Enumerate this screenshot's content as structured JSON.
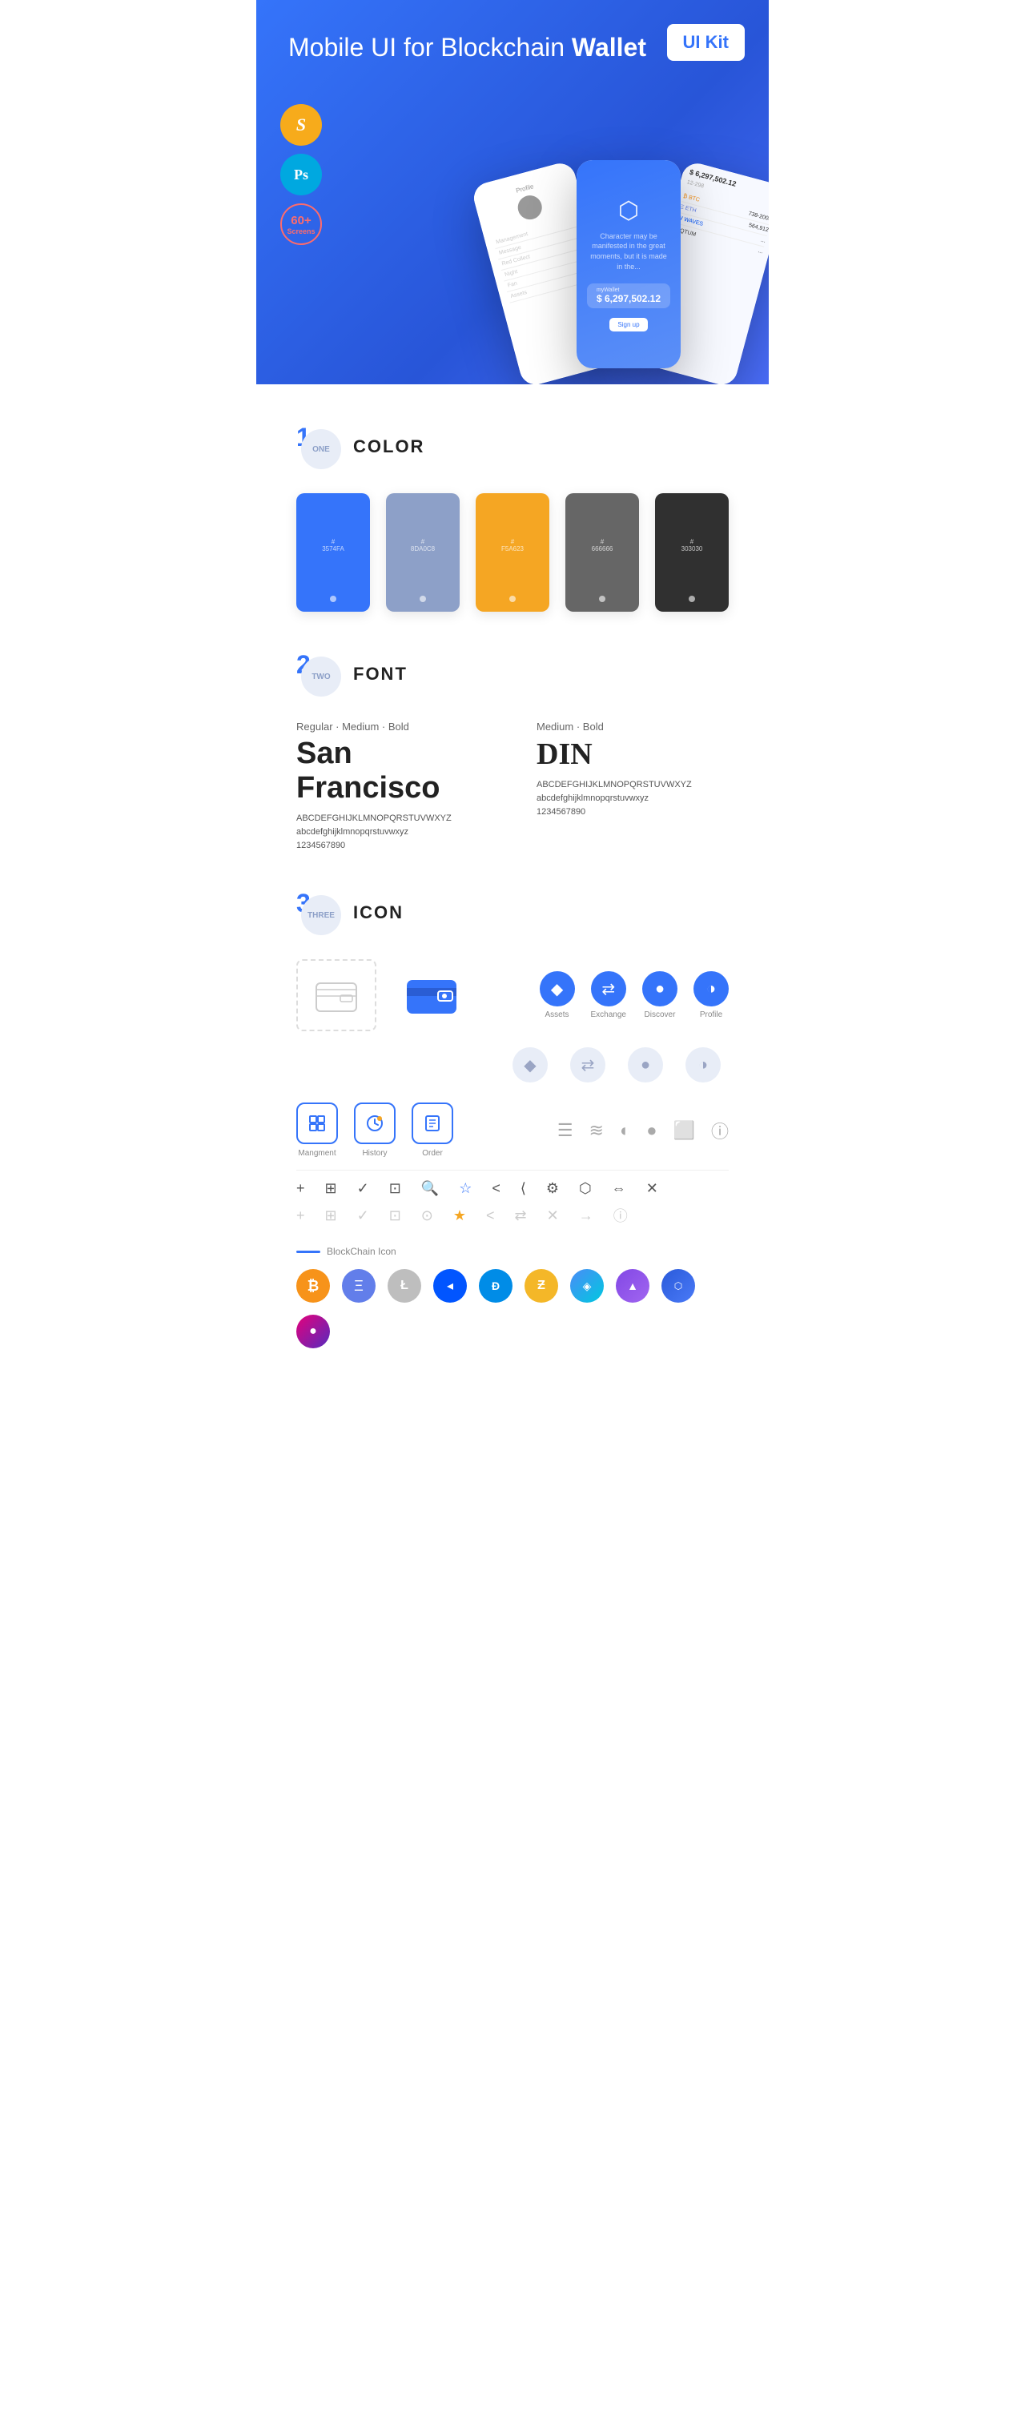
{
  "hero": {
    "title": "Mobile UI for Blockchain ",
    "title_bold": "Wallet",
    "badge": "UI Kit",
    "badges": [
      {
        "label": "Sketch",
        "type": "sketch"
      },
      {
        "label": "Ps",
        "type": "ps"
      },
      {
        "label": "60+\nScreens",
        "type": "screens"
      }
    ]
  },
  "sections": {
    "color": {
      "number": "1",
      "number_text": "ONE",
      "title": "COLOR",
      "swatches": [
        {
          "hex": "#3574FA",
          "code": "#\n3574FA"
        },
        {
          "hex": "#8DA0C8",
          "code": "#\n8DA0C8"
        },
        {
          "hex": "#F5A623",
          "code": "#\nF5A623"
        },
        {
          "hex": "#666666",
          "code": "#\n666666"
        },
        {
          "hex": "#303030",
          "code": "#\n303030"
        }
      ]
    },
    "font": {
      "number": "2",
      "number_text": "TWO",
      "title": "FONT",
      "fonts": [
        {
          "styles": "Regular · Medium · Bold",
          "name": "San Francisco",
          "uppercase": "ABCDEFGHIJKLMNOPQRSTUVWXYZ",
          "lowercase": "abcdefghijklmnopqrstuvwxyz",
          "numbers": "1234567890"
        },
        {
          "styles": "Medium · Bold",
          "name": "DIN",
          "uppercase": "ABCDEFGHIJKLMNOPQRSTUVWXYZ",
          "lowercase": "abcdefghijklmnopqrstuvwxyz",
          "numbers": "1234567890"
        }
      ]
    },
    "icon": {
      "number": "3",
      "number_text": "THREE",
      "title": "ICON",
      "main_icons": [
        {
          "label": "Assets",
          "icon": "◆"
        },
        {
          "label": "Exchange",
          "icon": "⇄"
        },
        {
          "label": "Discover",
          "icon": "●"
        },
        {
          "label": "Profile",
          "icon": "◑"
        }
      ],
      "nav_icons": [
        {
          "label": "Mangment",
          "icon": "⊡"
        },
        {
          "label": "History",
          "icon": "◷"
        },
        {
          "label": "Order",
          "icon": "≡"
        }
      ],
      "misc_icons": [
        "≡",
        "≋",
        "◐",
        "●",
        "☐",
        "ℹ"
      ],
      "tool_icons_active": [
        "+",
        "⊞",
        "✓",
        "⊡",
        "🔍",
        "☆",
        "<",
        "≺",
        "⚙",
        "⬡",
        "⇔",
        "✕"
      ],
      "tool_icons_inactive": [
        "+",
        "⊞",
        "✓",
        "⊡",
        "🔍",
        "☆",
        "<",
        "⇄",
        "✕",
        "→",
        "ℹ"
      ],
      "blockchain_label": "BlockChain Icon",
      "crypto_coins": [
        {
          "symbol": "₿",
          "class": "coin-btc",
          "label": "Bitcoin"
        },
        {
          "symbol": "Ξ",
          "class": "coin-eth",
          "label": "Ethereum"
        },
        {
          "symbol": "Ł",
          "class": "coin-ltc",
          "label": "Litecoin"
        },
        {
          "symbol": "W",
          "class": "coin-waves",
          "label": "Waves"
        },
        {
          "symbol": "Đ",
          "class": "coin-dash",
          "label": "Dash"
        },
        {
          "symbol": "Z",
          "class": "coin-zcash",
          "label": "Zcash"
        },
        {
          "symbol": "◈",
          "class": "coin-grid",
          "label": "Grid"
        },
        {
          "symbol": "▲",
          "class": "coin-matic",
          "label": "Matic"
        },
        {
          "symbol": "⬡",
          "class": "coin-link",
          "label": "Chainlink"
        },
        {
          "symbol": "●",
          "class": "coin-dot",
          "label": "Polkadot"
        }
      ]
    }
  }
}
